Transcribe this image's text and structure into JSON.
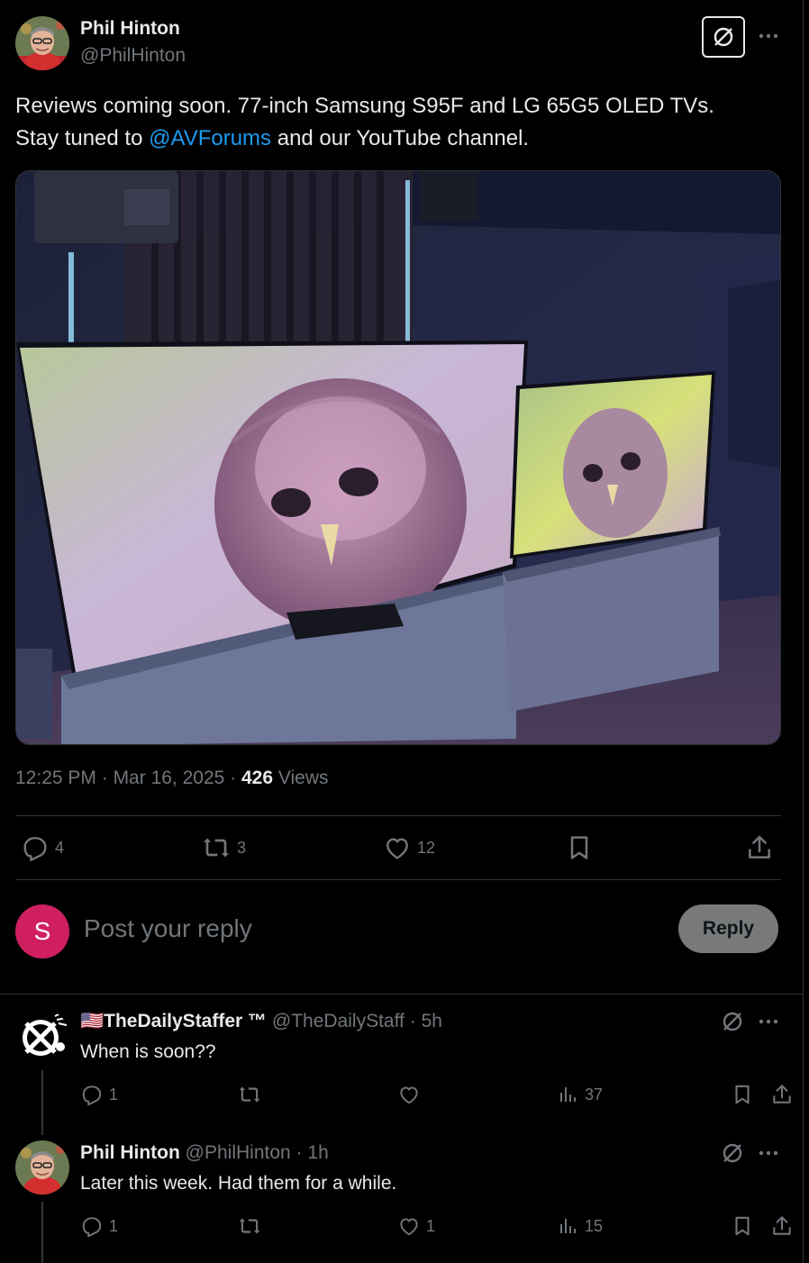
{
  "post": {
    "author_name": "Phil Hinton",
    "author_handle": "@PhilHinton",
    "text_line1": "Reviews coming soon. 77-inch Samsung S95F and LG 65G5 OLED TVs.",
    "text_line2_prefix": "Stay tuned to ",
    "text_mention": "@AVForums",
    "text_line2_suffix": " and our YouTube channel.",
    "time": "12:25 PM",
    "date": "Mar 16, 2025",
    "views_count": "426",
    "views_label": "Views",
    "replies": "4",
    "reposts": "3",
    "likes": "12"
  },
  "compose": {
    "avatar_letter": "S",
    "placeholder": "Post your reply",
    "reply_label": "Reply"
  },
  "replies": [
    {
      "flag": "🇺🇸",
      "name": "TheDailyStaffer ™",
      "handle": "@TheDailyStaff",
      "time": "5h",
      "text": "When is soon??",
      "replies": "1",
      "reposts": "",
      "likes": "",
      "views": "37"
    },
    {
      "name": "Phil Hinton",
      "handle": "@PhilHinton",
      "time": "1h",
      "text": "Later this week. Had them for a while.",
      "replies": "1",
      "reposts": "",
      "likes": "1",
      "views": "15"
    }
  ],
  "colors": {
    "accent": "#1d9bf0",
    "compose_avatar": "#cf1f61",
    "muted": "#71767b"
  }
}
